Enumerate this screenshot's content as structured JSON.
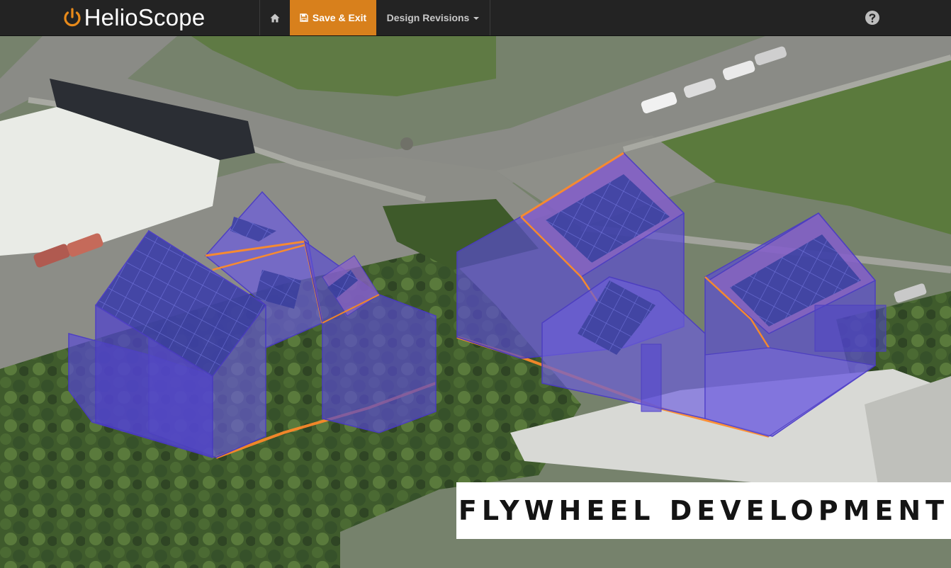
{
  "navbar": {
    "brand": "HelioScope",
    "home_icon": "home-icon",
    "save_icon": "floppy-disk-icon",
    "save_label": "Save & Exit",
    "revisions_label": "Design Revisions",
    "help_icon": "question-circle-icon"
  },
  "banner": {
    "text": "FLYWHEEL DEVELOPMENT"
  },
  "colors": {
    "navbar": "#232323",
    "accent": "#d8801c",
    "building_fill": "#5a4bd6",
    "building_edge": "#4a3ac8",
    "edge_highlight": "#ff8a2a",
    "panel": "#3e40a8"
  }
}
